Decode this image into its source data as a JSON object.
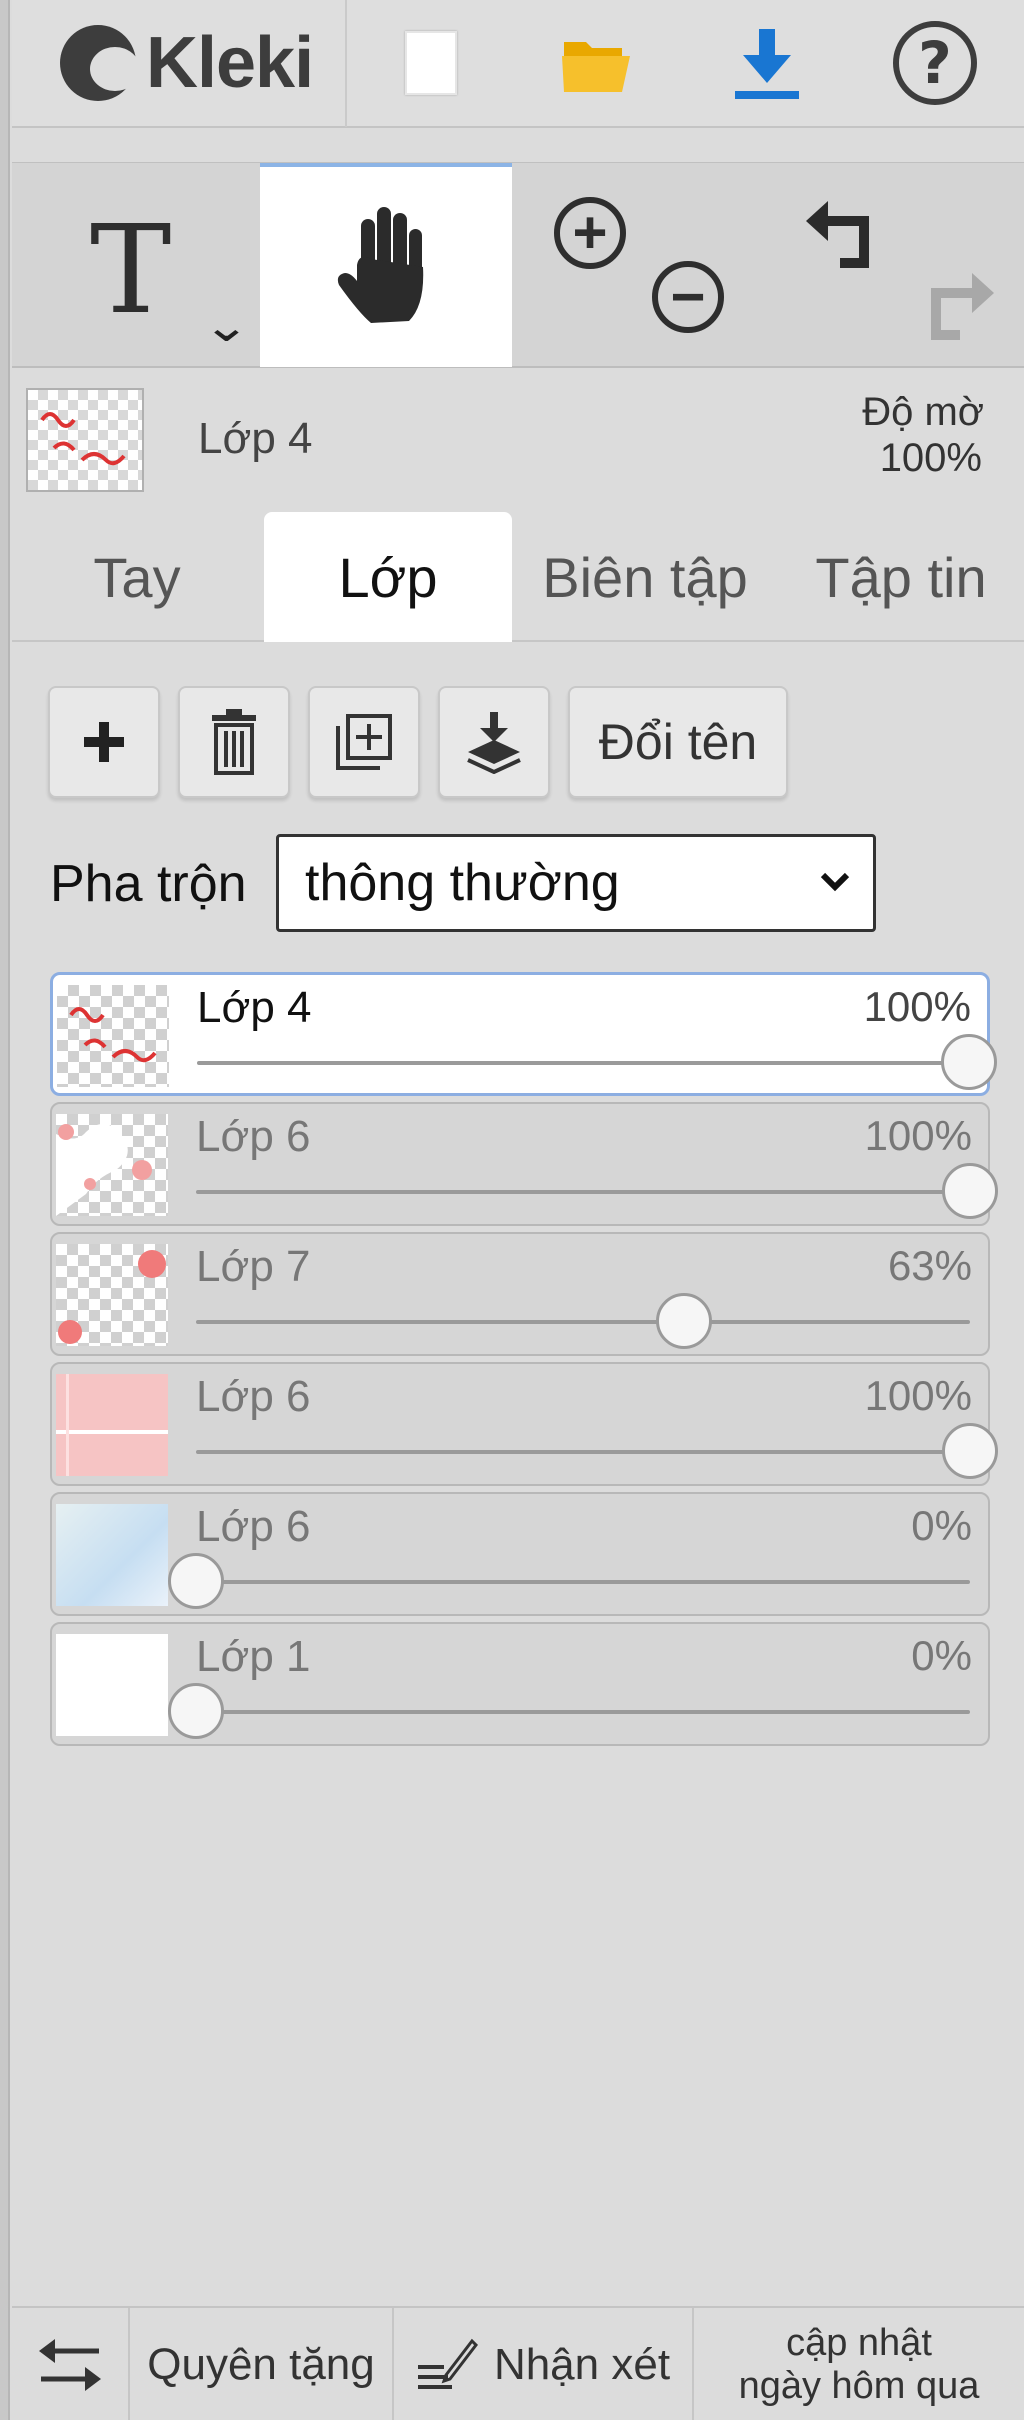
{
  "header": {
    "logo_text": "Kleki",
    "help_glyph": "?",
    "icons": [
      "new-document-icon",
      "open-folder-icon",
      "download-icon",
      "help-icon"
    ],
    "colors": {
      "folder": "#f4b400",
      "download": "#1976d2"
    }
  },
  "tools": {
    "text_glyph": "T",
    "chevron": "⌄",
    "zoom_in_glyph": "+",
    "zoom_out_glyph": "−",
    "icons": [
      "text-tool-icon",
      "hand-tool-icon",
      "zoom-in-icon",
      "zoom-out-icon",
      "undo-icon",
      "redo-icon"
    ],
    "active": "hand"
  },
  "current_layer": {
    "name": "Lớp 4",
    "opacity_label": "Độ mờ",
    "opacity_value": "100%"
  },
  "tabs": [
    {
      "label": "Tay"
    },
    {
      "label": "Lớp"
    },
    {
      "label": "Biên tập"
    },
    {
      "label": "Tập tin"
    }
  ],
  "active_tab": "Lớp",
  "layer_toolbar": {
    "icons": [
      "add-layer-icon",
      "delete-layer-icon",
      "duplicate-layer-icon",
      "merge-down-icon"
    ],
    "rename_label": "Đổi tên"
  },
  "blend": {
    "label": "Pha trộn",
    "value": "thông thường"
  },
  "layers": [
    {
      "name": "Lớp 4",
      "opacity": "100%",
      "level": 1.0,
      "active": true
    },
    {
      "name": "Lớp 6",
      "opacity": "100%",
      "level": 1.0,
      "active": false
    },
    {
      "name": "Lớp 7",
      "opacity": "63%",
      "level": 0.63,
      "active": false
    },
    {
      "name": "Lớp 6",
      "opacity": "100%",
      "level": 1.0,
      "active": false
    },
    {
      "name": "Lớp 6",
      "opacity": "0%",
      "level": 0.0,
      "active": false
    },
    {
      "name": "Lớp 1",
      "opacity": "0%",
      "level": 0.0,
      "active": false
    }
  ],
  "footer": {
    "swap_icon": "swap-arrows-icon",
    "donate_label": "Quyên tặng",
    "feedback_label": "Nhận xét",
    "update_line1": "cập nhật",
    "update_line2": "ngày hôm qua"
  }
}
